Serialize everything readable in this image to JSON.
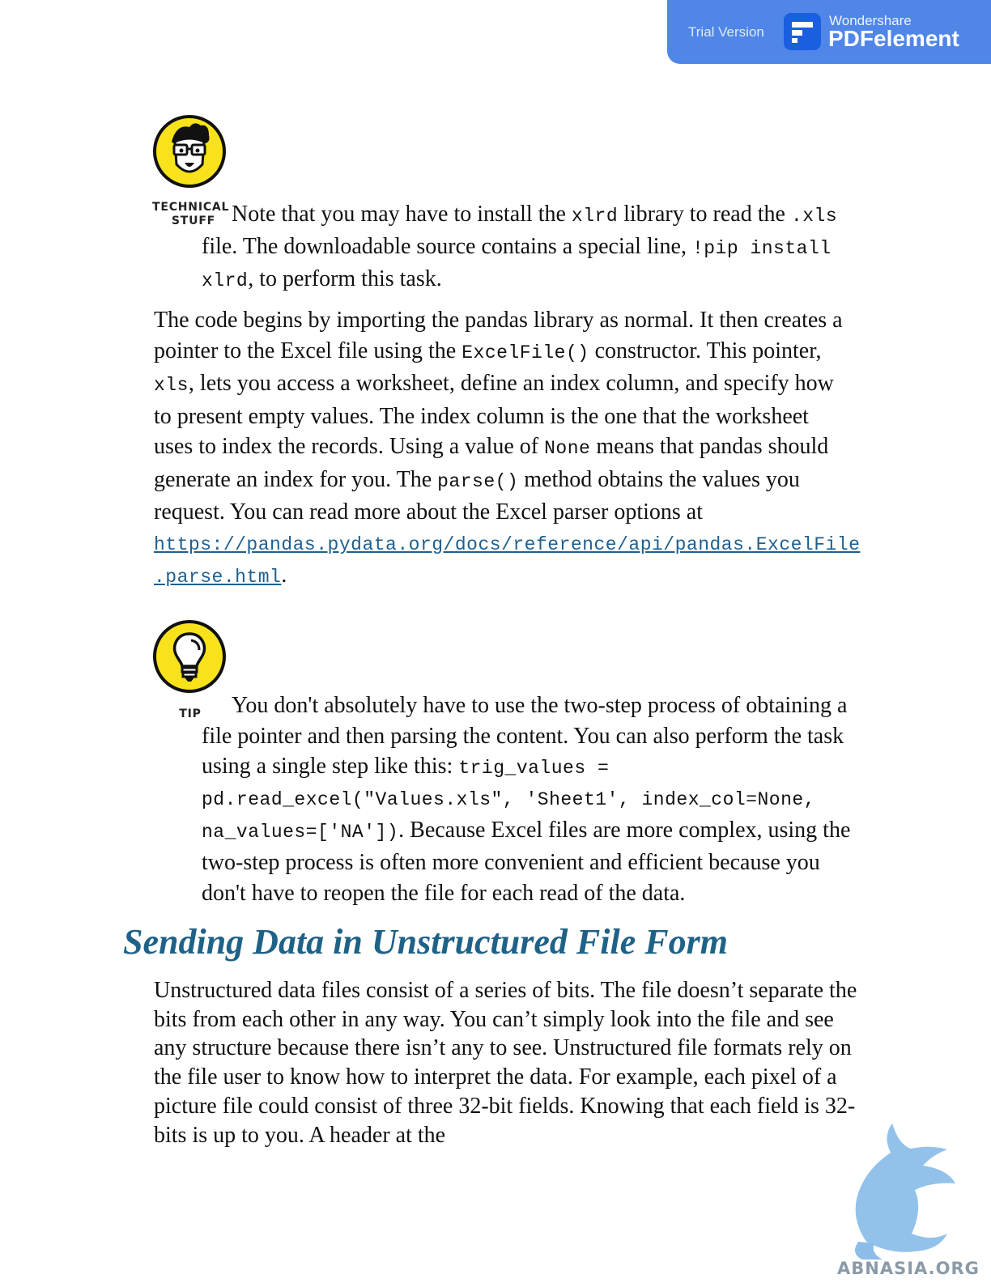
{
  "banner": {
    "trial_label": "Trial Version",
    "brand_small": "Wondershare",
    "brand_big": "PDFelement"
  },
  "technical_stuff": {
    "icon_caption_line1": "TECHNICAL",
    "icon_caption_line2": "STUFF",
    "t1": "Note that you may have to install the ",
    "c1": "xlrd",
    "t2": " library to read the ",
    "c2": ".xls",
    "t3": " file. The downloadable source contains a special line, ",
    "c3": "!pip install xlrd",
    "t4": ", to perform this task."
  },
  "body_paragraph": {
    "t1": "The code begins by importing the pandas library as normal. It then creates a pointer to the Excel file using the ",
    "c1": "ExcelFile()",
    "t2": " constructor. This pointer, ",
    "c2": "xls",
    "t3": ", lets you access a worksheet, define an index column, and specify how to present empty values. The index column is the one that the worksheet uses to index the records. Using a value of ",
    "c3": "None",
    "t4": " means that pandas should generate an index for you. The ",
    "c4": "parse()",
    "t5": " method obtains the values you request. You can read more about the Excel parser options at",
    "link_part1": "https://pandas.pydata.org/docs/reference/api/pandas.ExcelFile",
    "link_part2": ".parse.html",
    "t6": "."
  },
  "tip": {
    "icon_caption": "TIP",
    "t1": "You don't absolutely have to use the two-step process of obtaining a file pointer and then parsing the content. You can also perform the task using a single step like this: ",
    "c1": "trig_values =",
    "c2": "pd.read_excel(\"Values.xls\", 'Sheet1', index_col=None,",
    "c3": "na_values=['NA'])",
    "t2": ". Because Excel files are more complex, using the two-step process is often more convenient and efficient because you don't have to reopen the file for each read of the data."
  },
  "section": {
    "heading": "Sending Data in Unstructured File Form",
    "paragraph": "Unstructured data files consist of a series of bits. The file doesn’t separate the bits from each other in any way. You can’t simply look into the file and see any structure because there isn’t any to see. Unstructured file formats rely on the file user to know how to interpret the data. For example, each pixel of a picture file could consist of three 32-bit fields. Knowing that each field is 32-bits is up to you. A header at the"
  },
  "watermark": {
    "text": "ABNASIA.ORG"
  },
  "colors": {
    "banner": "#4f86e8",
    "heading": "#1f6287",
    "link": "#1f5f8f",
    "icon_yellow": "#f7e21b"
  }
}
